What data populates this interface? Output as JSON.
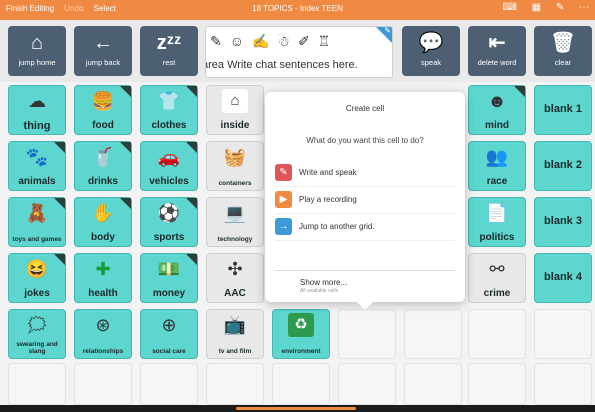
{
  "topbar": {
    "finish": "Finish Editing",
    "undo": "Undo",
    "select": "Select",
    "title": "18 TOPICS - Index TEEN",
    "icons": [
      "keyboard-icon",
      "grid-icon",
      "wrench-icon",
      "more-icon"
    ],
    "color": "#f08a42"
  },
  "toolbar": {
    "jump_home": "jump home",
    "jump_back": "jump back",
    "rest": "rest",
    "speak": "speak",
    "delete_word": "delete word",
    "clear": "clear",
    "sentence_text": "area   Write chat sentences here.",
    "button_color": "#4d6073"
  },
  "grid": {
    "thing": "thing",
    "food": "food",
    "clothes": "clothes",
    "inside": "inside",
    "mind": "mind",
    "blank1": "blank 1",
    "animals": "animals",
    "drinks": "drinks",
    "vehicles": "vehicles",
    "containers": "containers",
    "race": "race",
    "blank2": "blank 2",
    "toys": "toys and games",
    "body": "body",
    "sports": "sports",
    "technology": "technology",
    "politics": "politics",
    "blank3": "blank 3",
    "jokes": "jokes",
    "health": "health",
    "money": "money",
    "aac": "AAC",
    "crime": "crime",
    "blank4": "blank 4",
    "swearing": "swearing and slang",
    "relationships": "relationships",
    "social_care": "social care",
    "tv_film": "tv and film",
    "environment": "environment",
    "teal_color": "#5cd6cf"
  },
  "popup": {
    "title": "Create cell",
    "question": "What do you want this cell to do?",
    "opt1": "Write and speak",
    "opt2": "Play a recording",
    "opt3": "Jump to another grid.",
    "more": "Show more...",
    "more_sub": "All available cells",
    "opt_colors": [
      "#e0555a",
      "#f08a42",
      "#3c9ad6"
    ]
  }
}
